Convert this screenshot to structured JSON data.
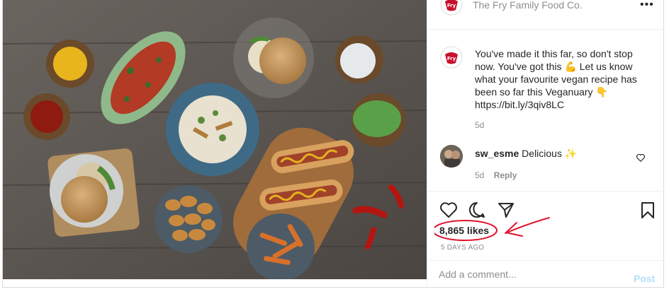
{
  "post": {
    "account": "The Fry Family Food Co.",
    "more_icon": "more-options-icon",
    "brand_color": "#c8102e"
  },
  "caption": {
    "text": "You've made it this far, so don't stop now. You've got this 💪 Let us know what your favourite vegan recipe has been so far this Veganuary 👇\nhttps://bit.ly/3qiv8LC",
    "time": "5d"
  },
  "comment": {
    "user": "sw_esme",
    "text": "Delicious ✨",
    "time": "5d",
    "reply": "Reply"
  },
  "actions": {
    "icons": [
      "heart-icon",
      "comment-icon",
      "share-icon",
      "bookmark-icon"
    ],
    "likes": "8,865 likes",
    "ago": "5 DAYS AGO",
    "annotation_color": "#e0142e"
  },
  "add_comment": {
    "placeholder": "Add a comment...",
    "post_label": "Post"
  }
}
